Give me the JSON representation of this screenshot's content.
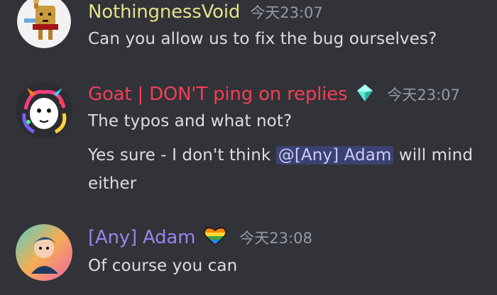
{
  "messages": [
    {
      "username": "NothingnessVoid",
      "username_color": "#e5e08a",
      "timestamp": "今天23:07",
      "lines": [
        "Can you allow us to fix the bug ourselves?"
      ]
    },
    {
      "username": "Goat | DON'T ping on replies",
      "username_color": "#f23f55",
      "badge_icon": "diamond-icon",
      "timestamp": "今天23:07",
      "lines": [
        "The typos and what not?"
      ],
      "line2_before": "Yes sure - I don't think ",
      "line2_mention": "@[Any] Adam",
      "line2_after": " will mind",
      "line3": "either"
    },
    {
      "username": "[Any] Adam",
      "username_color": "#9b84ec",
      "badge_icon": "rainbow-heart-icon",
      "timestamp": "今天23:08",
      "lines": [
        "Of course you can"
      ]
    }
  ]
}
